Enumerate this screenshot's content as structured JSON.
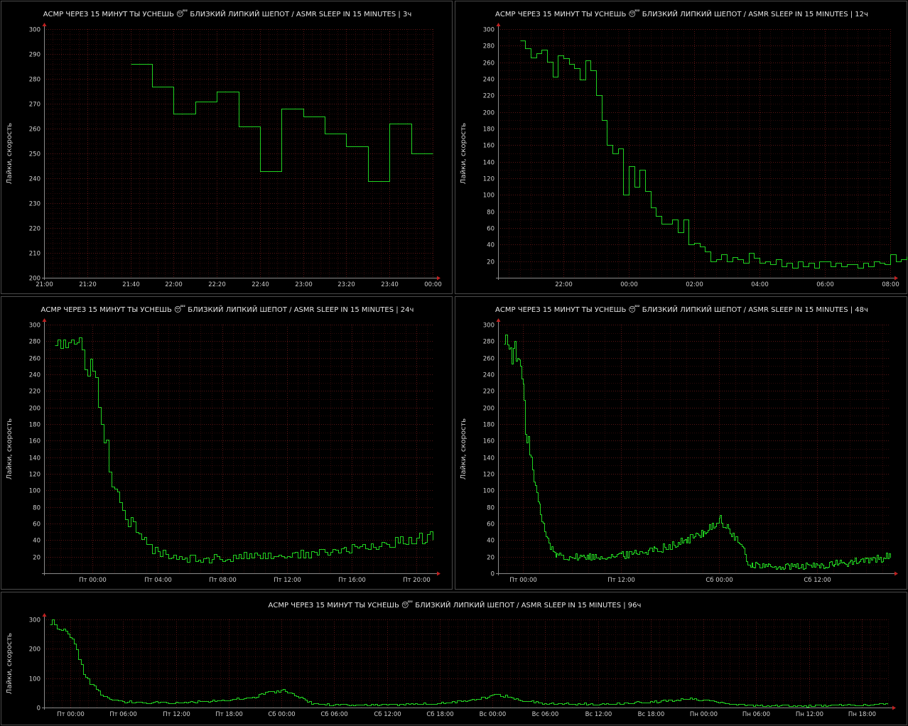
{
  "colors": {
    "background": "#000000",
    "series": "#21d321",
    "grid": "#5a1414",
    "text": "#e6e6e6"
  },
  "chart_data": [
    {
      "type": "line",
      "title": "АСМР ЧЕРЕЗ 15 МИНУТ ТЫ УСНЕШЬ 😴 БЛИЗКИЙ ЛИПКИЙ ШЕПОТ / ASMR SLEEP IN 15 MINUTES | 3ч",
      "ylabel": "Лайки, скорость",
      "ylim": [
        200,
        300
      ],
      "xlim": [
        0,
        180
      ],
      "yticks": [
        200,
        210,
        220,
        230,
        240,
        250,
        260,
        270,
        280,
        290,
        300
      ],
      "xticks": [
        {
          "x": 0,
          "label": "21:00"
        },
        {
          "x": 20,
          "label": "21:20"
        },
        {
          "x": 40,
          "label": "21:40"
        },
        {
          "x": 60,
          "label": "22:00"
        },
        {
          "x": 80,
          "label": "22:20"
        },
        {
          "x": 100,
          "label": "22:40"
        },
        {
          "x": 120,
          "label": "23:00"
        },
        {
          "x": 140,
          "label": "23:20"
        },
        {
          "x": 160,
          "label": "23:40"
        },
        {
          "x": 180,
          "label": "00:00"
        }
      ],
      "series": [
        {
          "x": [
            40,
            50,
            60,
            70,
            80,
            90,
            100,
            110,
            120,
            130,
            140,
            150,
            160,
            170,
            180
          ],
          "y": [
            286,
            277,
            266,
            271,
            275,
            261,
            243,
            268,
            265,
            258,
            253,
            239,
            262,
            250,
            250
          ]
        }
      ]
    },
    {
      "type": "line",
      "title": "АСМР ЧЕРЕЗ 15 МИНУТ ТЫ УСНЕШЬ 😴 БЛИЗКИЙ ЛИПКИЙ ШЕПОТ / ASMR SLEEP IN 15 MINUTES | 12ч",
      "ylabel": "Лайки, скорость",
      "ylim": [
        0,
        300
      ],
      "xlim": [
        0,
        720
      ],
      "yticks": [
        20,
        40,
        60,
        80,
        100,
        120,
        140,
        160,
        180,
        200,
        220,
        240,
        260,
        280,
        300
      ],
      "xticks": [
        {
          "x": 120,
          "label": "22:00"
        },
        {
          "x": 240,
          "label": "00:00"
        },
        {
          "x": 360,
          "label": "02:00"
        },
        {
          "x": 480,
          "label": "04:00"
        },
        {
          "x": 600,
          "label": "06:00"
        },
        {
          "x": 720,
          "label": "08:00"
        }
      ],
      "series": [
        {
          "x": [
            40,
            50,
            60,
            70,
            80,
            90,
            100,
            110,
            120,
            130,
            140,
            150,
            160,
            170,
            180,
            190,
            200,
            210,
            220,
            230,
            240,
            250,
            260,
            270,
            280,
            290,
            300,
            310,
            320,
            330,
            340,
            350,
            360,
            370,
            380,
            390,
            400,
            410,
            420,
            430,
            440,
            450,
            460,
            470,
            480,
            490,
            500,
            510,
            520,
            530,
            540,
            550,
            560,
            570,
            580,
            590,
            600,
            610,
            620,
            630,
            640,
            650,
            660,
            670,
            680,
            690,
            700,
            710,
            720,
            730,
            740,
            750
          ],
          "y": [
            286,
            277,
            266,
            271,
            275,
            261,
            243,
            268,
            265,
            258,
            253,
            239,
            262,
            250,
            220,
            190,
            160,
            150,
            156,
            100,
            135,
            110,
            130,
            105,
            85,
            75,
            65,
            65,
            70,
            55,
            70,
            40,
            42,
            38,
            32,
            20,
            22,
            28,
            20,
            25,
            22,
            18,
            30,
            24,
            18,
            20,
            16,
            22,
            14,
            18,
            12,
            20,
            14,
            18,
            12,
            20,
            20,
            14,
            18,
            14,
            16,
            16,
            12,
            18,
            14,
            20,
            18,
            16,
            28,
            20,
            22,
            26
          ]
        }
      ]
    },
    {
      "type": "line",
      "title": "АСМР ЧЕРЕЗ 15 МИНУТ ТЫ УСНЕШЬ 😴 БЛИЗКИЙ ЛИПКИЙ ШЕПОТ / ASMR SLEEP IN 15 MINUTES | 24ч",
      "ylabel": "Лайки, скорость",
      "ylim": [
        0,
        300
      ],
      "xlim": [
        0,
        1440
      ],
      "yticks": [
        20,
        40,
        60,
        80,
        100,
        120,
        140,
        160,
        180,
        200,
        220,
        240,
        260,
        280,
        300
      ],
      "xticks": [
        {
          "x": 180,
          "label": "Пт 00:00"
        },
        {
          "x": 420,
          "label": "Пт 04:00"
        },
        {
          "x": 660,
          "label": "Пт 08:00"
        },
        {
          "x": 900,
          "label": "Пт 12:00"
        },
        {
          "x": 1140,
          "label": "Пт 16:00"
        },
        {
          "x": 1380,
          "label": "Пт 20:00"
        }
      ],
      "series": [
        {
          "generator": "walk",
          "seed": 24,
          "anchors": [
            [
              40,
              286
            ],
            [
              120,
              270
            ],
            [
              160,
              255
            ],
            [
              180,
              245
            ],
            [
              190,
              230
            ],
            [
              200,
              205
            ],
            [
              215,
              160
            ],
            [
              230,
              150
            ],
            [
              250,
              115
            ],
            [
              270,
              90
            ],
            [
              290,
              70
            ],
            [
              320,
              62
            ],
            [
              350,
              45
            ],
            [
              400,
              28
            ],
            [
              500,
              20
            ],
            [
              600,
              18
            ],
            [
              700,
              20
            ],
            [
              800,
              22
            ],
            [
              900,
              22
            ],
            [
              1000,
              24
            ],
            [
              1100,
              28
            ],
            [
              1200,
              32
            ],
            [
              1300,
              38
            ],
            [
              1380,
              42
            ],
            [
              1440,
              45
            ]
          ],
          "noise": 10,
          "step": 10
        }
      ]
    },
    {
      "type": "line",
      "title": "АСМР ЧЕРЕЗ 15 МИНУТ ТЫ УСНЕШЬ 😴 БЛИЗКИЙ ЛИПКИЙ ШЕПОТ / ASMR SLEEP IN 15 MINUTES | 48ч",
      "ylabel": "Лайки, скорость",
      "ylim": [
        0,
        300
      ],
      "xlim": [
        0,
        2880
      ],
      "yticks": [
        0,
        20,
        40,
        60,
        80,
        100,
        120,
        140,
        160,
        180,
        200,
        220,
        240,
        260,
        280,
        300
      ],
      "xticks": [
        {
          "x": 180,
          "label": "Пт 00:00"
        },
        {
          "x": 900,
          "label": "Пт 12:00"
        },
        {
          "x": 1620,
          "label": "Сб 00:00"
        },
        {
          "x": 2340,
          "label": "Сб 12:00"
        }
      ],
      "series": [
        {
          "generator": "walk",
          "seed": 48,
          "anchors": [
            [
              40,
              286
            ],
            [
              120,
              265
            ],
            [
              160,
              250
            ],
            [
              200,
              180
            ],
            [
              230,
              150
            ],
            [
              260,
              110
            ],
            [
              300,
              80
            ],
            [
              340,
              50
            ],
            [
              400,
              25
            ],
            [
              500,
              20
            ],
            [
              700,
              20
            ],
            [
              900,
              22
            ],
            [
              1100,
              28
            ],
            [
              1300,
              35
            ],
            [
              1450,
              45
            ],
            [
              1550,
              55
            ],
            [
              1620,
              65
            ],
            [
              1700,
              50
            ],
            [
              1780,
              35
            ],
            [
              1830,
              12
            ],
            [
              2000,
              8
            ],
            [
              2200,
              8
            ],
            [
              2400,
              10
            ],
            [
              2600,
              14
            ],
            [
              2800,
              18
            ],
            [
              2880,
              22
            ]
          ],
          "noise": 9,
          "step": 10
        }
      ]
    },
    {
      "type": "line",
      "title": "АСМР ЧЕРЕЗ 15 МИНУТ ТЫ УСНЕШЬ 😴 БЛИЗКИЙ ЛИПКИЙ ШЕПОТ / ASMR SLEEP IN 15 MINUTES | 96ч",
      "ylabel": "Лайки, скорость",
      "ylim": [
        0,
        300
      ],
      "xlim": [
        0,
        5760
      ],
      "yticks": [
        0,
        100,
        200,
        300
      ],
      "xticks": [
        {
          "x": 180,
          "label": "Пт 00:00"
        },
        {
          "x": 540,
          "label": "Пт 06:00"
        },
        {
          "x": 900,
          "label": "Пт 12:00"
        },
        {
          "x": 1260,
          "label": "Пт 18:00"
        },
        {
          "x": 1620,
          "label": "Сб 00:00"
        },
        {
          "x": 1980,
          "label": "Сб 06:00"
        },
        {
          "x": 2340,
          "label": "Сб 12:00"
        },
        {
          "x": 2700,
          "label": "Сб 18:00"
        },
        {
          "x": 3060,
          "label": "Вс 00:00"
        },
        {
          "x": 3420,
          "label": "Вс 06:00"
        },
        {
          "x": 3780,
          "label": "Вс 12:00"
        },
        {
          "x": 4140,
          "label": "Вс 18:00"
        },
        {
          "x": 4500,
          "label": "Пн 00:00"
        },
        {
          "x": 4860,
          "label": "Пн 06:00"
        },
        {
          "x": 5220,
          "label": "Пн 12:00"
        },
        {
          "x": 5580,
          "label": "Пн 18:00"
        }
      ],
      "series": [
        {
          "generator": "walk",
          "seed": 96,
          "anchors": [
            [
              40,
              290
            ],
            [
              120,
              265
            ],
            [
              180,
              250
            ],
            [
              220,
              200
            ],
            [
              260,
              120
            ],
            [
              320,
              80
            ],
            [
              400,
              40
            ],
            [
              500,
              22
            ],
            [
              700,
              18
            ],
            [
              900,
              18
            ],
            [
              1100,
              22
            ],
            [
              1300,
              28
            ],
            [
              1450,
              40
            ],
            [
              1550,
              55
            ],
            [
              1620,
              60
            ],
            [
              1720,
              40
            ],
            [
              1830,
              15
            ],
            [
              2000,
              10
            ],
            [
              2400,
              10
            ],
            [
              2800,
              18
            ],
            [
              3000,
              35
            ],
            [
              3100,
              45
            ],
            [
              3200,
              30
            ],
            [
              3400,
              15
            ],
            [
              3800,
              12
            ],
            [
              4200,
              22
            ],
            [
              4400,
              30
            ],
            [
              4600,
              18
            ],
            [
              4800,
              8
            ],
            [
              5200,
              6
            ],
            [
              5600,
              10
            ],
            [
              5760,
              14
            ]
          ],
          "noise": 7,
          "step": 15
        }
      ]
    }
  ]
}
